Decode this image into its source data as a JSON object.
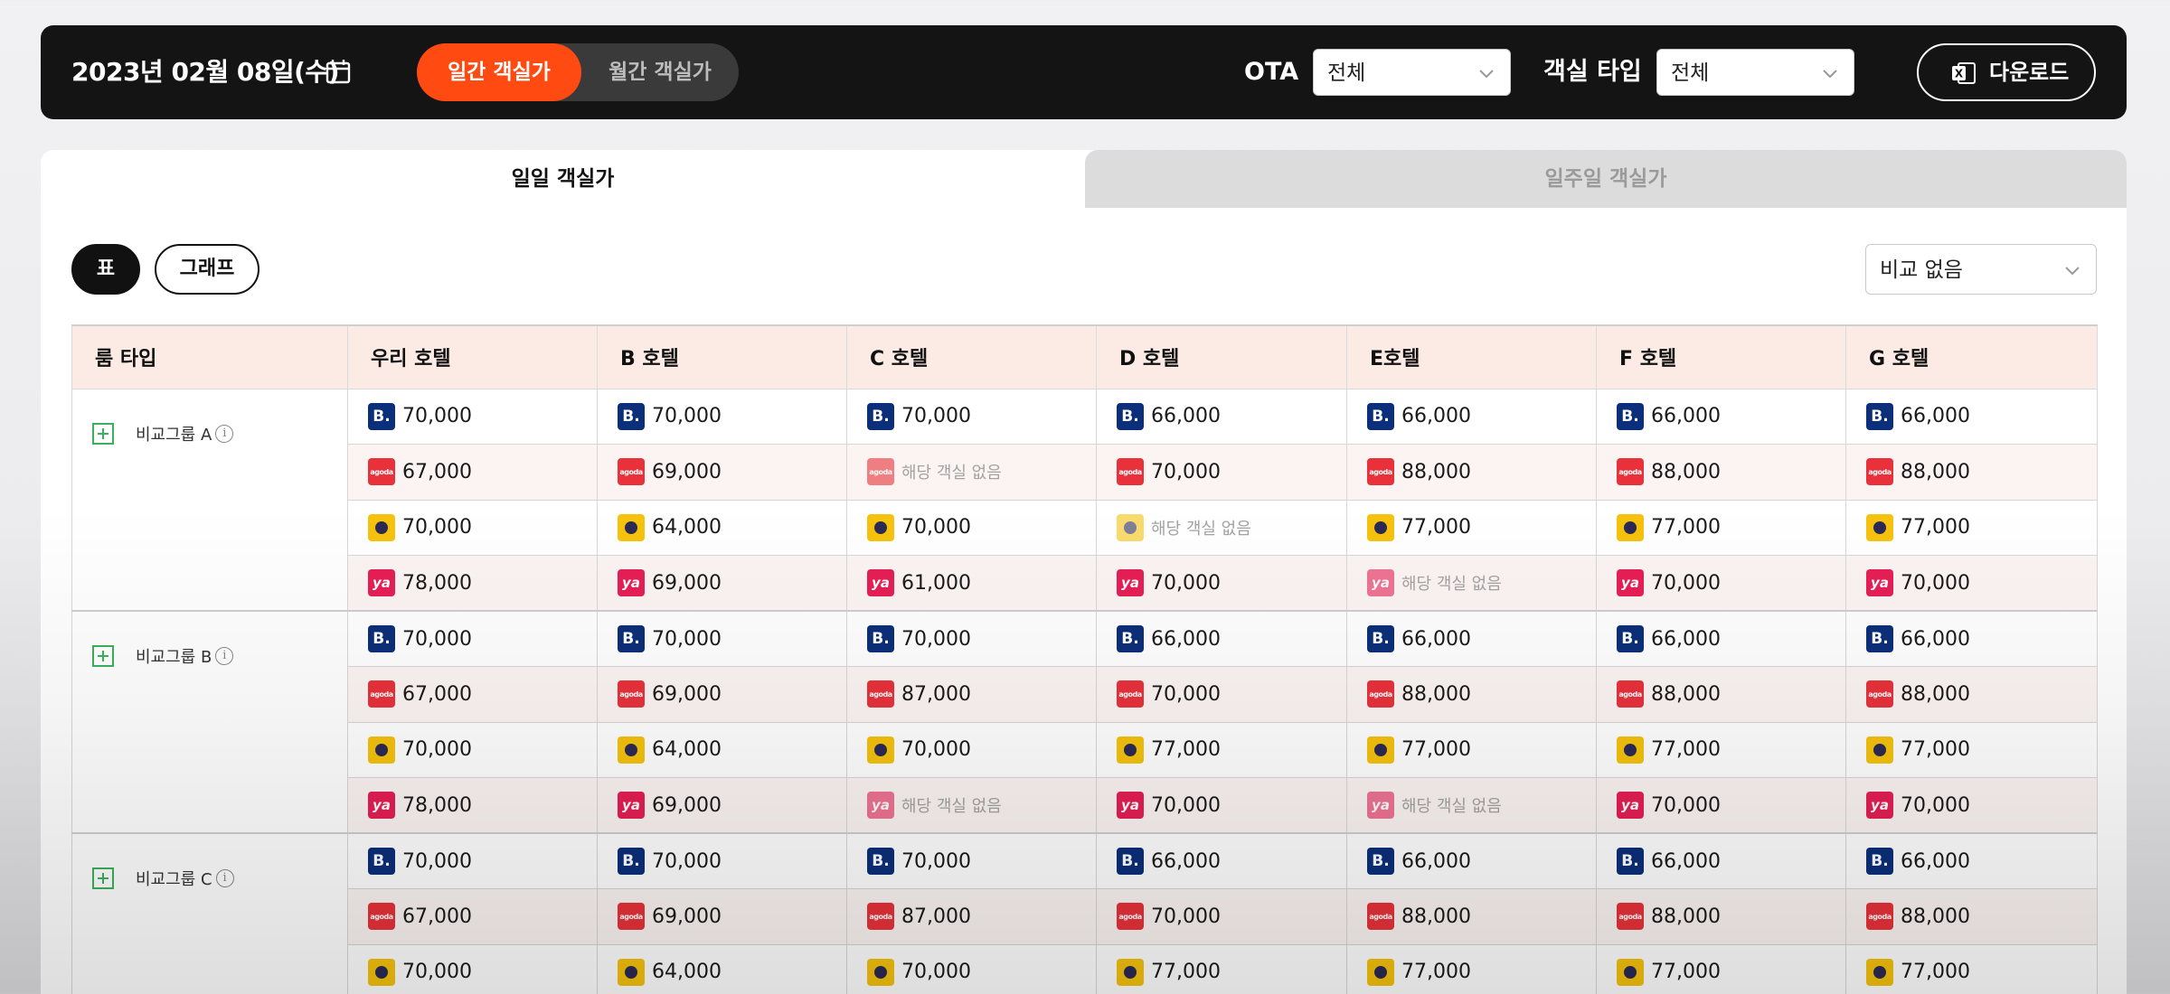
{
  "header": {
    "date": "2023년 02월 08일(수)",
    "segment": {
      "daily": "일간 객실가",
      "monthly": "월간 객실가"
    },
    "ota_label": "OTA",
    "ota_value": "전체",
    "room_type_label": "객실 타입",
    "room_type_value": "전체",
    "download_label": "다운로드"
  },
  "tabs": {
    "daily": "일일 객실가",
    "weekly": "일주일 객실가"
  },
  "view": {
    "table": "표",
    "graph": "그래프"
  },
  "compare_select": "비교 없음",
  "table": {
    "headers": [
      "룸 타입",
      "우리 호텔",
      "B 호텔",
      "C 호텔",
      "D 호텔",
      "E호텔",
      "F 호텔",
      "G 호텔"
    ],
    "na_text": "해당 객실 없음",
    "groups": [
      {
        "name": "비교그룹 A",
        "rows": [
          {
            "ota": "booking",
            "values": [
              "70,000",
              "70,000",
              "70,000",
              "66,000",
              "66,000",
              "66,000",
              "66,000"
            ]
          },
          {
            "ota": "agoda",
            "values": [
              "67,000",
              "69,000",
              null,
              "70,000",
              "88,000",
              "88,000",
              "88,000"
            ]
          },
          {
            "ota": "yeogi",
            "values": [
              "70,000",
              "64,000",
              "70,000",
              null,
              "77,000",
              "77,000",
              "77,000"
            ]
          },
          {
            "ota": "ya",
            "values": [
              "78,000",
              "69,000",
              "61,000",
              "70,000",
              null,
              "70,000",
              "70,000"
            ]
          }
        ]
      },
      {
        "name": "비교그룹 B",
        "rows": [
          {
            "ota": "booking",
            "values": [
              "70,000",
              "70,000",
              "70,000",
              "66,000",
              "66,000",
              "66,000",
              "66,000"
            ]
          },
          {
            "ota": "agoda",
            "values": [
              "67,000",
              "69,000",
              "87,000",
              "70,000",
              "88,000",
              "88,000",
              "88,000"
            ]
          },
          {
            "ota": "yeogi",
            "values": [
              "70,000",
              "64,000",
              "70,000",
              "77,000",
              "77,000",
              "77,000",
              "77,000"
            ]
          },
          {
            "ota": "ya",
            "values": [
              "78,000",
              "69,000",
              null,
              "70,000",
              null,
              "70,000",
              "70,000"
            ]
          }
        ]
      },
      {
        "name": "비교그룹 C",
        "rows": [
          {
            "ota": "booking",
            "values": [
              "70,000",
              "70,000",
              "70,000",
              "66,000",
              "66,000",
              "66,000",
              "66,000"
            ]
          },
          {
            "ota": "agoda",
            "values": [
              "67,000",
              "69,000",
              "87,000",
              "70,000",
              "88,000",
              "88,000",
              "88,000"
            ]
          },
          {
            "ota": "yeogi",
            "values": [
              "70,000",
              "64,000",
              "70,000",
              "77,000",
              "77,000",
              "77,000",
              "77,000"
            ]
          }
        ]
      }
    ]
  },
  "ota_logos": {
    "booking": {
      "icon": "booking-icon",
      "glyph": "B.",
      "color": "#0b2f7a"
    },
    "agoda": {
      "icon": "agoda-icon",
      "glyph": "agoda",
      "color": "#e8313a"
    },
    "yeogi": {
      "icon": "yeogi-icon",
      "glyph": "",
      "color": "#f6c20d"
    },
    "ya": {
      "icon": "yanolja-icon",
      "glyph": "ya",
      "color": "#e61e55"
    }
  },
  "colors": {
    "accent": "#ff4a12",
    "header_bg": "#141414",
    "table_head_bg": "#fcebe5"
  }
}
